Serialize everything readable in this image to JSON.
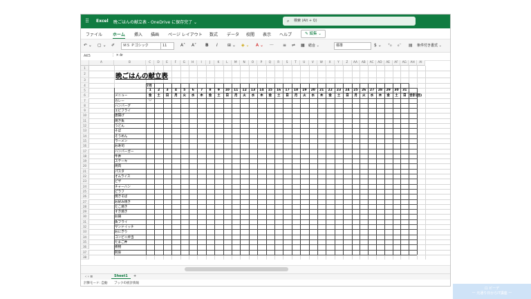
{
  "app": {
    "name": "Excel",
    "document": "晩ごはんの献立表 - OneDrive に保存完了 ⌄"
  },
  "search": {
    "placeholder": "検索 (Alt + Q)"
  },
  "tabs": [
    "ファイル",
    "ホーム",
    "挿入",
    "描画",
    "ページ レイアウト",
    "数式",
    "データ",
    "校閲",
    "表示",
    "ヘルプ"
  ],
  "active_tab": "ホーム",
  "edit_button": "✎ 編集 ⌄",
  "ribbon": {
    "font_name": "ＭＳ Ｐゴシック",
    "font_size": "11",
    "number_format": "標準",
    "merge_label": "結合 ⌄",
    "conditional_format": "条件付き書式 ⌄",
    "more": "···"
  },
  "formula_bar": {
    "name_box": "AK5",
    "fx": "fx"
  },
  "columns": [
    "A",
    "B",
    "C",
    "D",
    "E",
    "F",
    "G",
    "H",
    "I",
    "J",
    "K",
    "L",
    "M",
    "N",
    "O",
    "P",
    "Q",
    "R",
    "S",
    "T",
    "U",
    "V",
    "W",
    "X",
    "Y",
    "Z",
    "AA",
    "AB",
    "AC",
    "AD",
    "AE",
    "AF",
    "AG",
    "AH",
    "AI"
  ],
  "rows": [
    "1",
    "2",
    "3",
    "4",
    "5",
    "6",
    "7",
    "8",
    "9",
    "10",
    "11",
    "12",
    "13",
    "14",
    "15",
    "16",
    "17",
    "18",
    "19",
    "20",
    "21",
    "22",
    "23",
    "24",
    "25",
    "26",
    "27",
    "28",
    "29",
    "30",
    "31",
    "32",
    "33",
    "34",
    "35",
    "36",
    "37",
    "38"
  ],
  "sheet": {
    "title": "晩ごはんの献立表",
    "month": "7月",
    "menu_header": "メニュー",
    "total_header": "合計(回)",
    "days": [
      "1",
      "2",
      "3",
      "4",
      "5",
      "6",
      "7",
      "8",
      "9",
      "10",
      "11",
      "12",
      "13",
      "14",
      "15",
      "16",
      "17",
      "18",
      "19",
      "20",
      "21",
      "22",
      "23",
      "24",
      "25",
      "26",
      "27",
      "28",
      "29",
      "30",
      "31"
    ],
    "weekdays": [
      "金",
      "土",
      "日",
      "月",
      "火",
      "水",
      "木",
      "金",
      "土",
      "日",
      "月",
      "火",
      "水",
      "木",
      "金",
      "土",
      "日",
      "月",
      "火",
      "水",
      "木",
      "金",
      "土",
      "日",
      "月",
      "火",
      "水",
      "木",
      "金",
      "土",
      "日"
    ],
    "menu": [
      "カレー",
      "ハンバーグ",
      "エビフライ",
      "唐揚げ",
      "焼き魚",
      "うどん",
      "そば",
      "そうめん",
      "ラーメン",
      "お寿司",
      "ハンバーガー",
      "牛丼",
      "ステーキ",
      "焼肉",
      "パスタ",
      "オムライス",
      "ピザ",
      "チャーハン",
      "ピラフ",
      "焼きそば",
      "お好み焼き",
      "たこ焼き",
      "すき焼き",
      "お鍋",
      "魚フライ",
      "サンドイッチ",
      "おにぎり",
      "コンビニ弁当",
      "たまご丼",
      "煮物",
      "刺身"
    ],
    "marks": [
      {
        "row": 0,
        "day": 0,
        "mark": "○"
      }
    ]
  },
  "sheet_tabs": {
    "active": "Sheet1",
    "add": "+"
  },
  "status": {
    "left": "計算モード: 自動",
    "right": "ブックの統計情報"
  },
  "watermark": {
    "line1": "ロ ビーデ",
    "line2": "一 元通り日からIT講座 一"
  }
}
